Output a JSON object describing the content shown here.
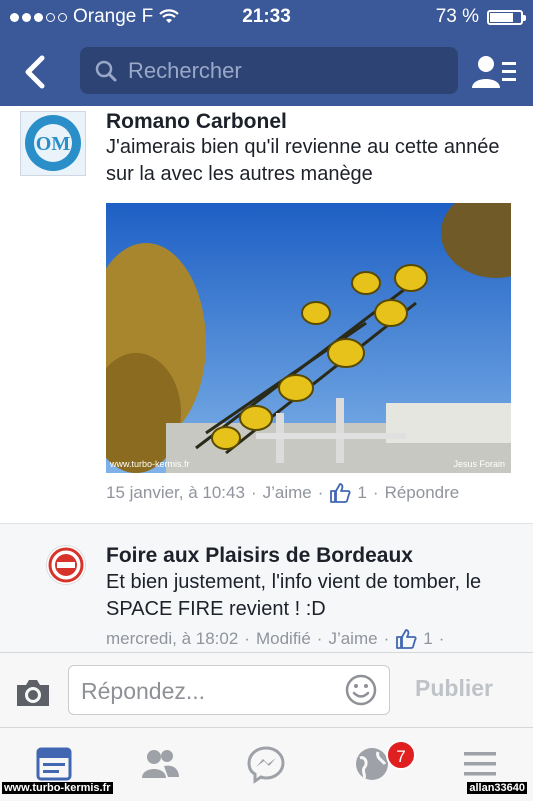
{
  "status_bar": {
    "carrier": "Orange F",
    "time": "21:33",
    "battery": "73 %"
  },
  "nav": {
    "search_placeholder": "Rechercher"
  },
  "comments": [
    {
      "author": "Romano Carbonel",
      "text": "J'aimerais bien qu'il revienne au cette année sur la avec les autres manège",
      "photo_watermark_left": "www.turbo-kermis.fr",
      "photo_watermark_right": "Jesus Forain",
      "time": "15 janvier, à 10:43",
      "like_label": "J’aime",
      "likes": "1",
      "reply_label": "Répondre"
    },
    {
      "author": "Foire aux Plaisirs de Bordeaux",
      "text": "Et bien justement, l'info vient de tomber, le SPACE FIRE revient ! :D",
      "time": "mercredi, à 18:02",
      "edited": "Modifié",
      "like_label": "J’aime",
      "likes": "1"
    }
  ],
  "composer": {
    "placeholder": "Répondez...",
    "publish": "Publier"
  },
  "tabbar": {
    "notifications_badge": "7"
  },
  "watermarks": {
    "left": "www.turbo-kermis.fr",
    "right": "allan33640"
  },
  "colors": {
    "brand": "#3b5998",
    "badge": "#e02020"
  }
}
